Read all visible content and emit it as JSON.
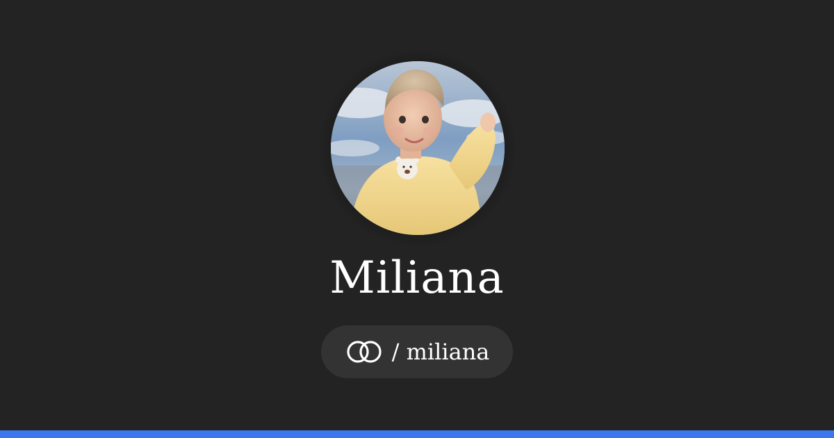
{
  "profile": {
    "name": "Miliana",
    "handle_separator": "/",
    "handle": "miliana",
    "handle_display": "/ miliana",
    "avatar_icon": "profile-photo"
  },
  "colors": {
    "background": "#232323",
    "pill": "#333333",
    "text": "#ffffff",
    "accent": "#3b78ee"
  },
  "icons": {
    "link": "linked-rings-icon"
  }
}
